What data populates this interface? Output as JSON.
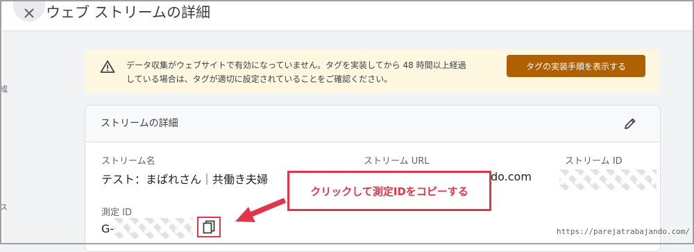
{
  "header": {
    "title": "ウェブ ストリームの詳細",
    "close_icon": "close-icon"
  },
  "gutter": {
    "mark_top": "成",
    "mark_bottom": "ス"
  },
  "banner": {
    "icon": "warning-icon",
    "line1": "データ収集がウェブサイトで有効になっていません。タグを実装してから 48 時間以上経過",
    "line2": "している場合は、タグが適切に設定されていることをご確認ください。",
    "button_label": "タグの実装手順を表示する",
    "button_color": "#b06000",
    "background": "#fef7e0"
  },
  "card": {
    "title": "ストリームの詳細",
    "edit_icon": "pencil-icon",
    "fields": {
      "stream_name_label": "ストリーム名",
      "stream_name_value": "テスト：まぱれさん｜共働き夫婦",
      "stream_url_label": "ストリーム URL",
      "stream_url_value": "do.com",
      "stream_id_label": "ストリーム ID",
      "measurement_id_label": "測定 ID",
      "measurement_id_prefix": "G-"
    },
    "copy_icon": "copy-icon"
  },
  "annotation": {
    "callout_text": "クリックして測定IDをコピーする",
    "accent": "#e0354a"
  },
  "watermark": "https://parejatrabajando.com/"
}
